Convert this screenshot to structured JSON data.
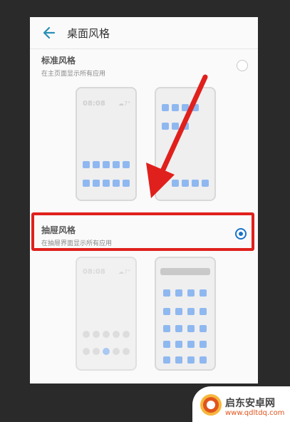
{
  "header": {
    "title": "桌面风格"
  },
  "options": [
    {
      "title": "标准风格",
      "subtitle": "在主页面显示所有应用",
      "selected": false,
      "preview": {
        "clock": "08:08",
        "weather": "☁7°"
      }
    },
    {
      "title": "抽屉风格",
      "subtitle": "在抽屉界面显示所有应用",
      "selected": true,
      "preview": {
        "clock": "08:08",
        "weather": "☁7°"
      }
    }
  ],
  "colors": {
    "highlight": "#e0201c",
    "radio_selected": "#1a73c8",
    "app_icon": "#8fb8f0"
  },
  "watermark": {
    "name": "启东安卓网",
    "url": "www.qdltdq.com"
  }
}
